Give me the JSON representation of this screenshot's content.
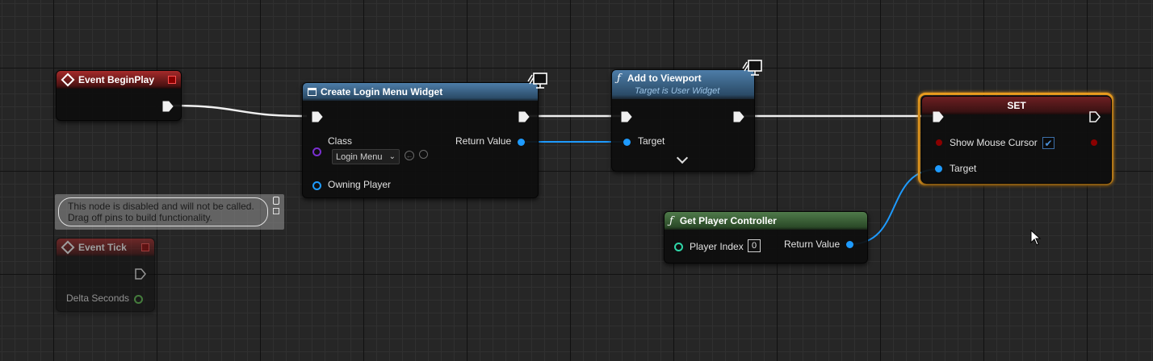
{
  "colors": {
    "exec_wire": "#f0f0f0",
    "object_pin": "#1e9bff",
    "class_pin": "#7a2fd0",
    "float_pin": "#5ec24e",
    "int_pin": "#2fd6a8",
    "bool_pin": "#8a0000",
    "selected_outline": "#f0a020"
  },
  "nodes": {
    "event_begin_play": {
      "title": "Event BeginPlay"
    },
    "create_widget": {
      "title": "Create Login Menu Widget",
      "class_label": "Class",
      "class_value": "Login Menu",
      "return_value_label": "Return Value",
      "owning_player_label": "Owning Player"
    },
    "add_to_viewport": {
      "title": "Add to Viewport",
      "subtitle": "Target is User Widget",
      "target_label": "Target"
    },
    "set_node": {
      "title": "SET",
      "show_mouse_cursor_label": "Show Mouse Cursor",
      "show_mouse_cursor_checked": true,
      "target_label": "Target"
    },
    "get_player_controller": {
      "title": "Get Player Controller",
      "player_index_label": "Player Index",
      "player_index_value": "0",
      "return_value_label": "Return Value"
    },
    "event_tick": {
      "title": "Event Tick",
      "delta_seconds_label": "Delta Seconds",
      "disabled_tooltip_line1": "This node is disabled and will not be called.",
      "disabled_tooltip_line2": "Drag off pins to build functionality."
    }
  }
}
